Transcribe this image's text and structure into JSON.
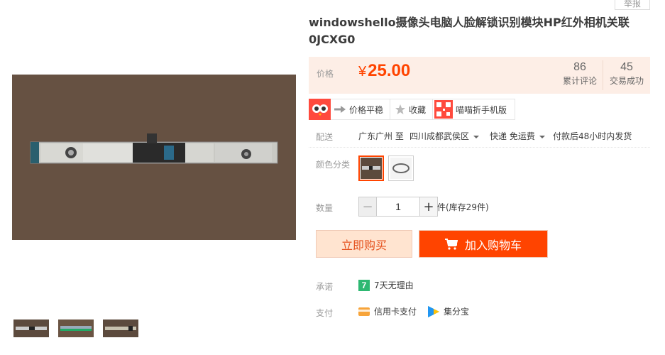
{
  "header": {
    "report_label": "举报"
  },
  "product": {
    "title": "windowshello摄像头电脑人脸解锁识别模块HP红外相机关联0JCXG0"
  },
  "price": {
    "label": "价格",
    "currency": "¥",
    "value": "25.00",
    "reviews_count": "86",
    "reviews_label": "累计评论",
    "deals_count": "45",
    "deals_label": "交易成功"
  },
  "tools": {
    "price_flat": "价格平稳",
    "favorite": "收藏",
    "mobile": "喵喵折手机版"
  },
  "shipping": {
    "label": "配送",
    "from": "广东广州 至",
    "to": "四川成都武侯区",
    "method": "快递 免运费",
    "dispatch": "付款后48小时内发货"
  },
  "color": {
    "label": "颜色分类"
  },
  "quantity": {
    "label": "数量",
    "minus": "−",
    "value": "1",
    "plus": "+",
    "stock": "件(库存29件)"
  },
  "actions": {
    "buy_now": "立即购买",
    "add_cart": "加入购物车"
  },
  "promise": {
    "label": "承诺",
    "badge": "7",
    "text": "7天无理由"
  },
  "payment": {
    "label": "支付",
    "credit": "信用卡支付",
    "jifenbao": "集分宝"
  },
  "colors": {
    "accent": "#ff4400",
    "price_bg": "#fdeee6",
    "buy_now_bg": "#ffe4d0",
    "promise_green": "#2eb872"
  }
}
